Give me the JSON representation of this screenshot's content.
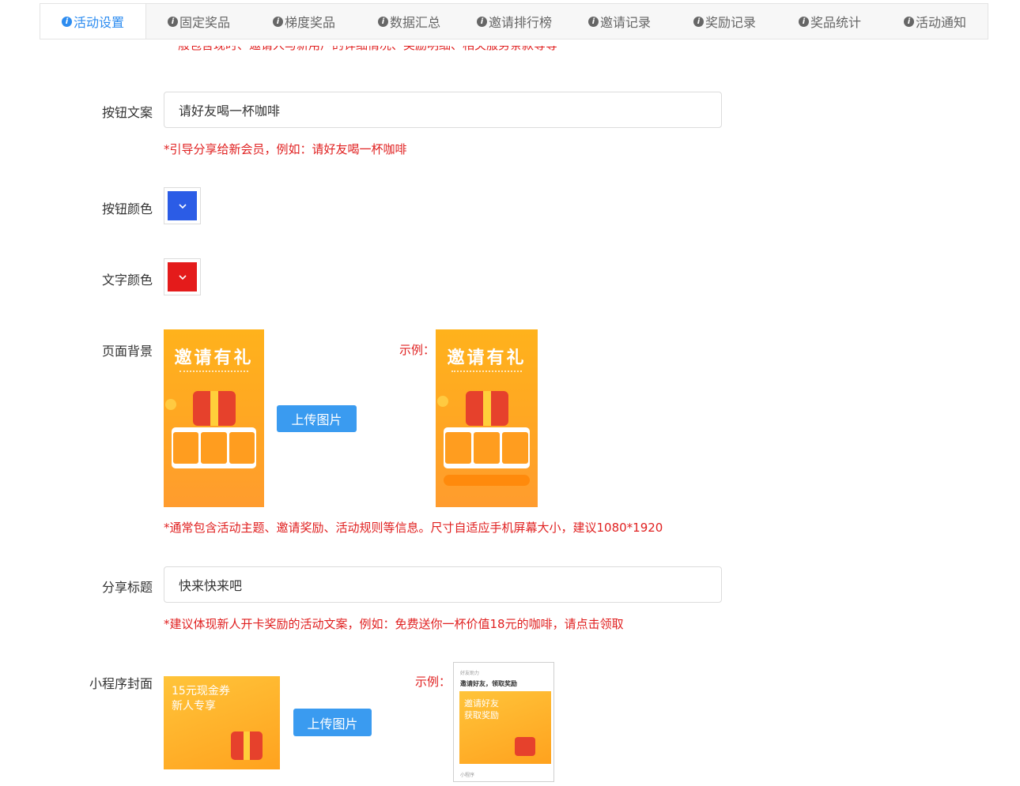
{
  "tabs": [
    {
      "label": "活动设置",
      "active": true
    },
    {
      "label": "固定奖品"
    },
    {
      "label": "梯度奖品"
    },
    {
      "label": "数据汇总"
    },
    {
      "label": "邀请排行榜"
    },
    {
      "label": "邀请记录"
    },
    {
      "label": "奖励记录"
    },
    {
      "label": "奖品统计"
    },
    {
      "label": "活动通知"
    }
  ],
  "cut_hint": "一般包含现时、邀请人与新用户的详细情况、奖励明细、相关服务条款等等",
  "button_text": {
    "label": "按钮文案",
    "value": "请好友喝一杯咖啡",
    "hint": "*引导分享给新会员，例如：请好友喝一杯咖啡"
  },
  "button_color": {
    "label": "按钮颜色",
    "color": "#2b5ce6",
    "icon": "chevron-down"
  },
  "text_color": {
    "label": "文字颜色",
    "color": "#e41b1b",
    "icon": "chevron-down"
  },
  "page_background": {
    "label": "页面背景",
    "poster_title": "邀请有礼",
    "upload_label": "上传图片",
    "example_label": "示例：",
    "example_title": "邀请有礼",
    "hint": "*通常包含活动主题、邀请奖励、活动规则等信息。尺寸自适应手机屏幕大小，建议1080*1920"
  },
  "share_title": {
    "label": "分享标题",
    "value": "快来快来吧",
    "hint": "*建议体现新人开卡奖励的活动文案，例如：免费送你一杯价值18元的咖啡，请点击领取"
  },
  "mini_cover": {
    "label": "小程序封面",
    "cover_line1": "15元现金券",
    "cover_line2": "新人专享",
    "upload_label": "上传图片",
    "example_label": "示例：",
    "phone_header": "好友助力",
    "phone_title": "邀请好友，领取奖励",
    "phone_line1": "邀请好友",
    "phone_line2": "获取奖励",
    "phone_footer": "小程序"
  }
}
